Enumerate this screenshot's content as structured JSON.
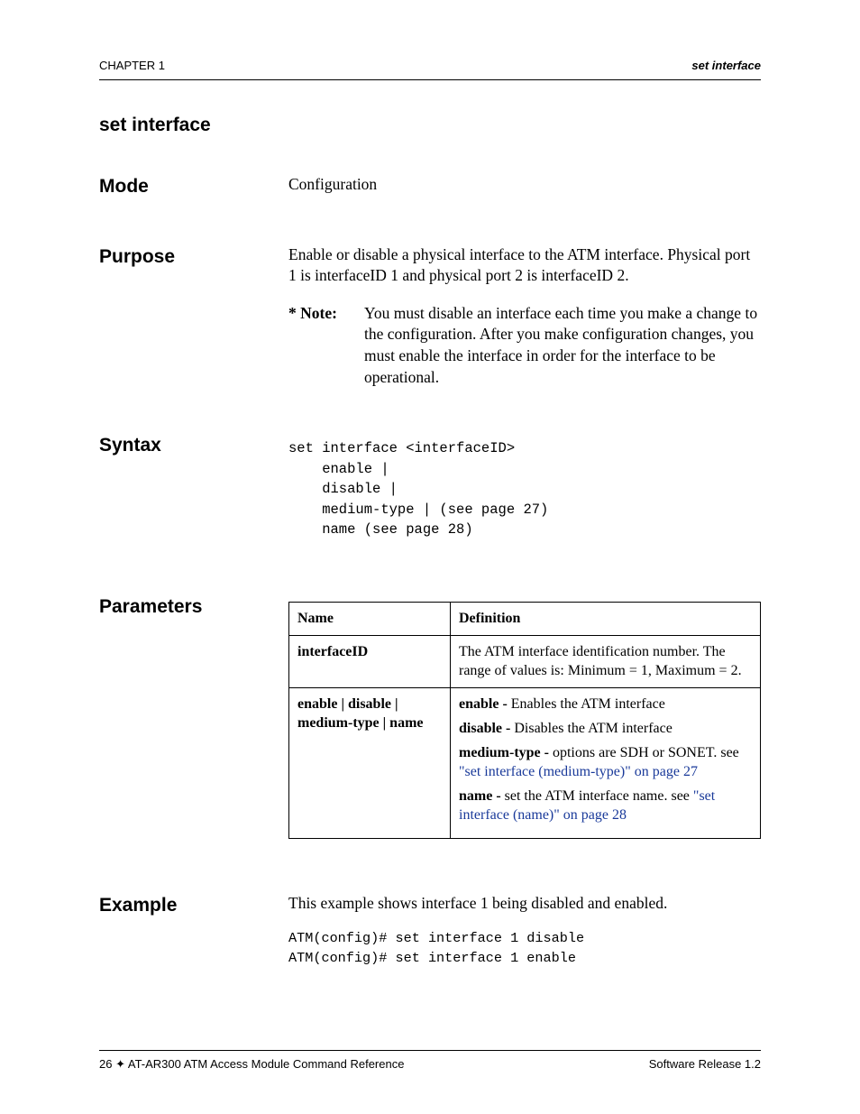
{
  "header": {
    "left": "CHAPTER 1",
    "right": "set interface"
  },
  "section_title": "set interface",
  "rows": {
    "mode": {
      "label": "Mode",
      "text": "Configuration"
    },
    "purpose": {
      "label": "Purpose",
      "text": "Enable or disable a physical interface to the ATM interface. Physical port 1 is interfaceID 1 and physical port 2 is interfaceID 2.",
      "note_label": "* Note:",
      "note_text": "You must disable an interface each time you make a change to the configuration. After you make configuration changes, you must enable the interface in order for the interface to be operational."
    },
    "syntax": {
      "label": "Syntax",
      "code": "set interface <interfaceID>\n    enable |\n    disable |\n    medium-type | (see page 27)\n    name (see page 28)"
    },
    "parameters": {
      "label": "Parameters",
      "table": {
        "headers": [
          "Name",
          "Definition"
        ],
        "rows": [
          {
            "name": "interfaceID",
            "def_plain": "The ATM interface identification number. The range of values is: Minimum = 1, Maximum = 2."
          },
          {
            "name": "enable | disable | medium-type | name",
            "defs": [
              {
                "bold": "enable - ",
                "text": "Enables the ATM interface"
              },
              {
                "bold": "disable - ",
                "text": "Disables the ATM interface"
              },
              {
                "bold": "medium-type - ",
                "text": "options are SDH or SONET. see ",
                "link": "\"set interface (medium-type)\" on page 27"
              },
              {
                "bold": "name - ",
                "text": "set the ATM interface name. see ",
                "link": "\"set interface (name)\" on page 28"
              }
            ]
          }
        ]
      }
    },
    "example": {
      "label": "Example",
      "text": "This example shows interface 1 being disabled and enabled.",
      "code": "ATM(config)# set interface 1 disable\nATM(config)# set interface 1 enable"
    }
  },
  "footer": {
    "left": "26  ✦  AT-AR300 ATM Access Module Command Reference",
    "right": "Software Release 1.2"
  }
}
